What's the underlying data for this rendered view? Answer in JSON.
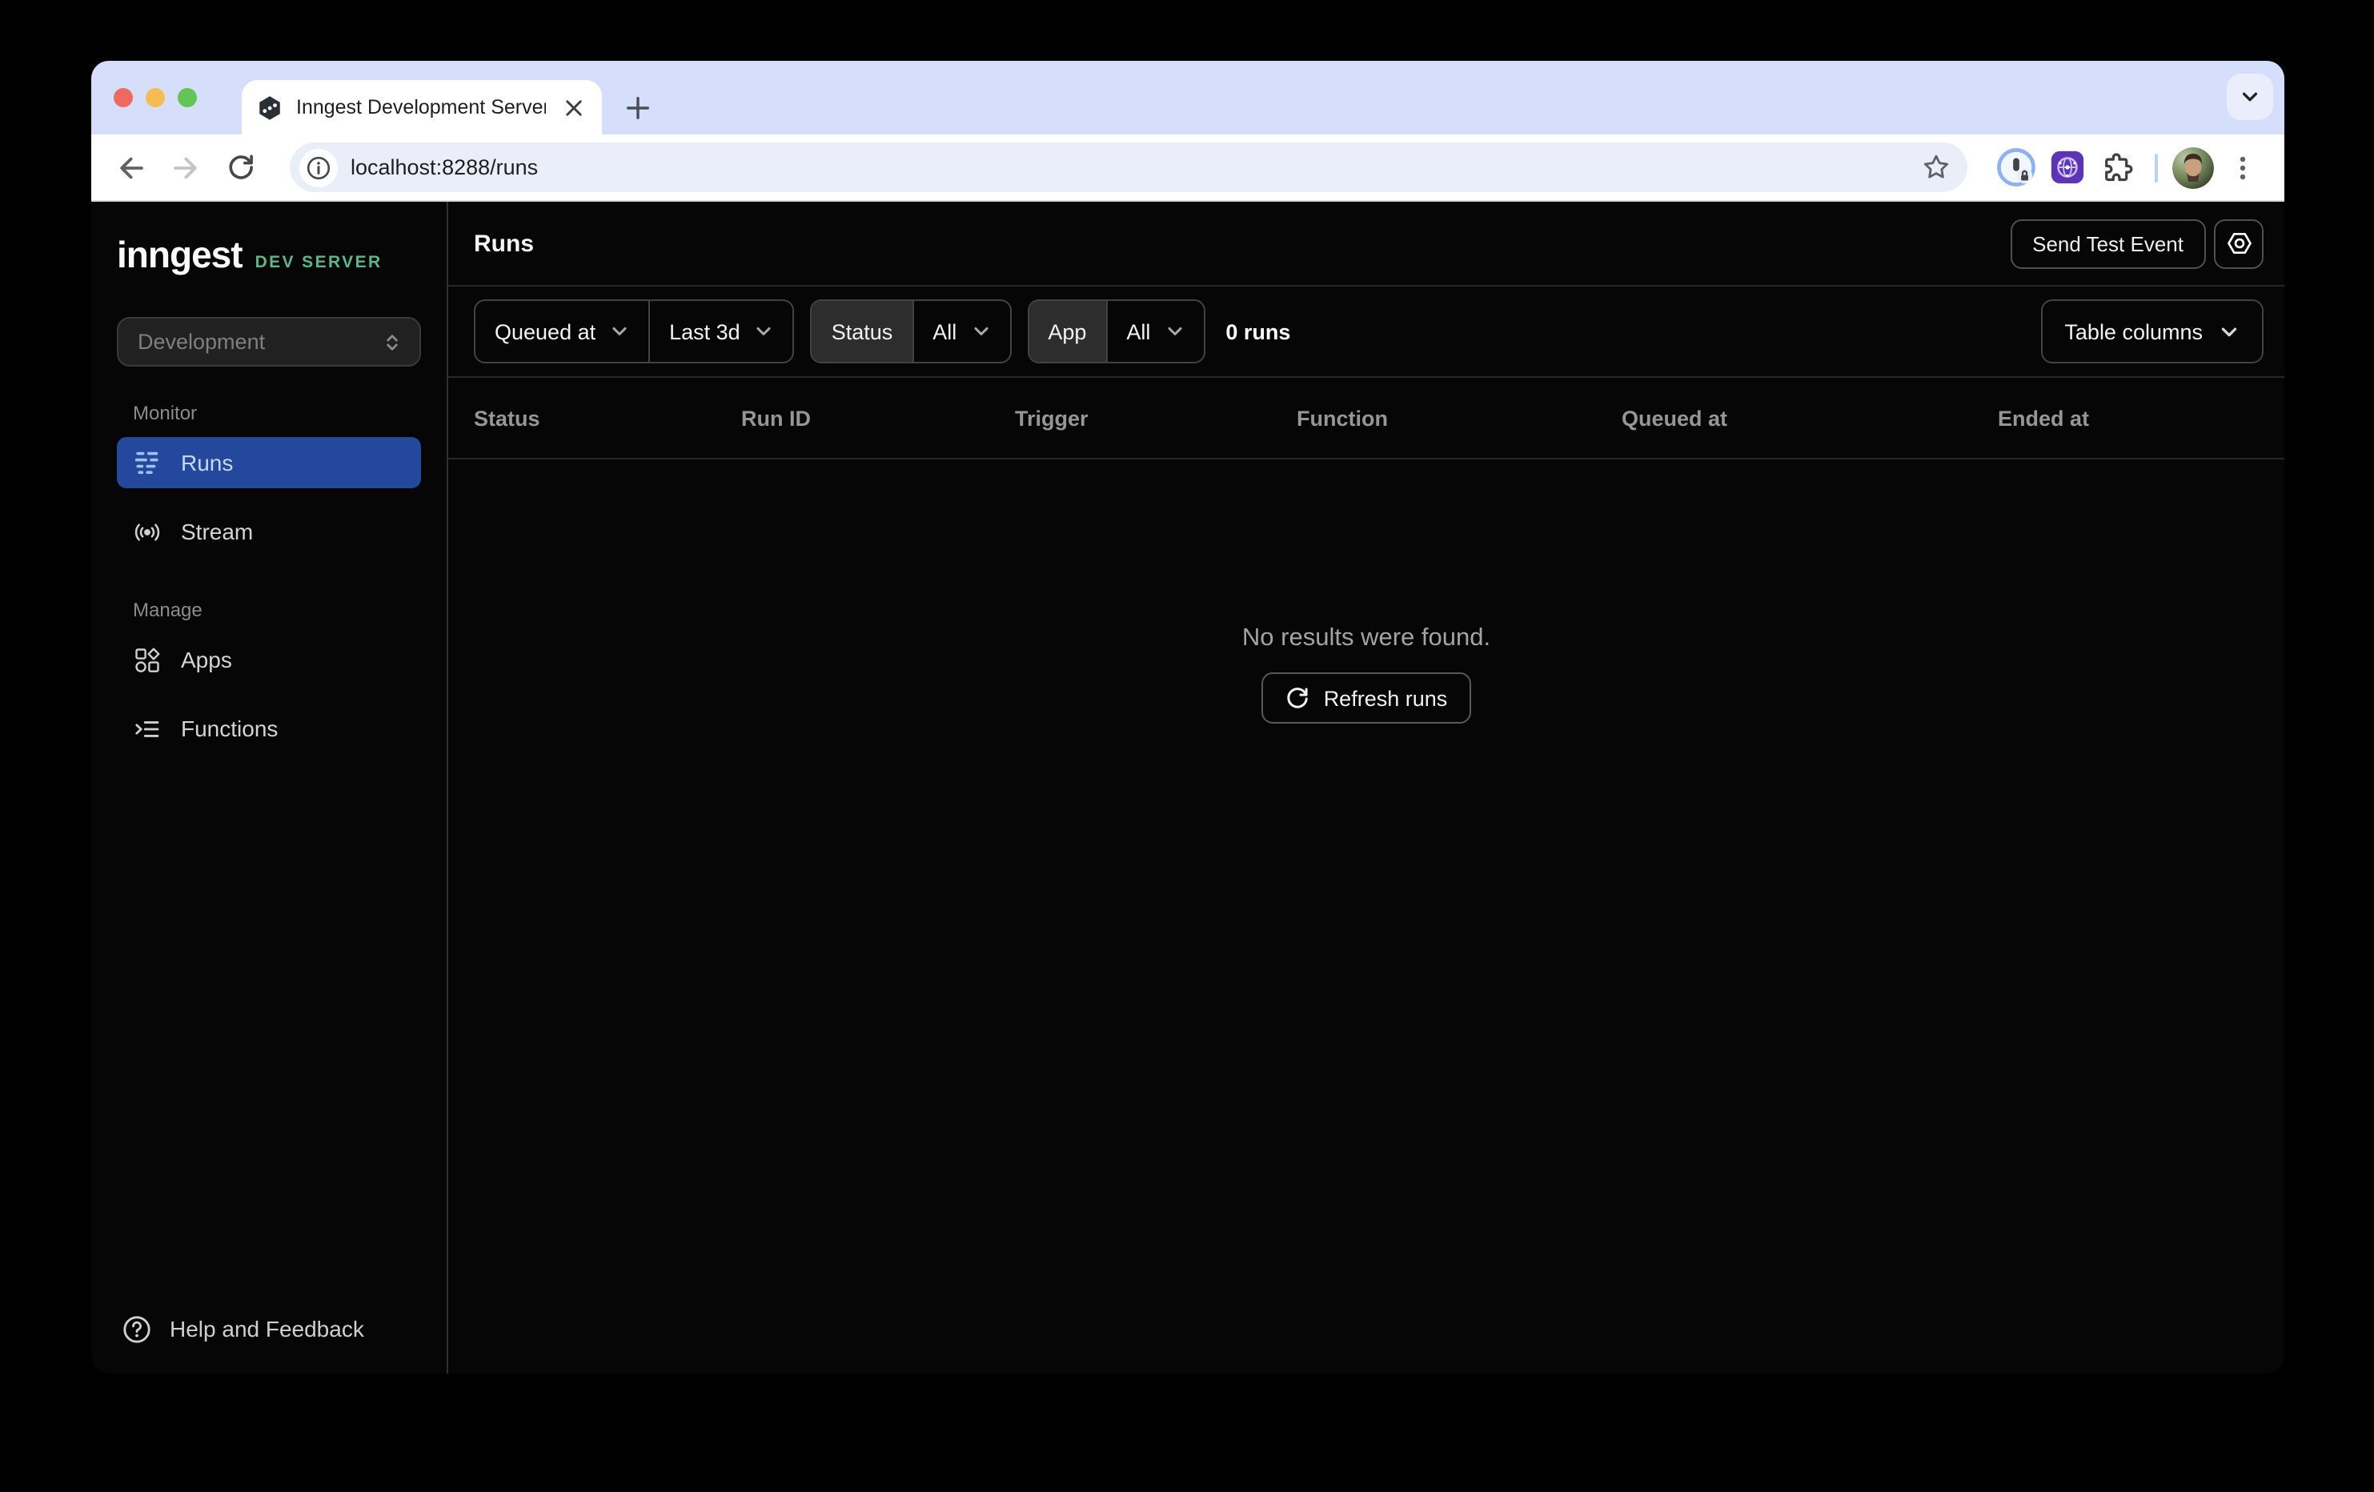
{
  "browser": {
    "tab_title": "Inngest Development Server",
    "url": "localhost:8288/runs"
  },
  "sidebar": {
    "logo": "inngest",
    "logo_badge": "DEV SERVER",
    "env_selector_value": "Development",
    "monitor_section_label": "Monitor",
    "manage_section_label": "Manage",
    "nav_runs_label": "Runs",
    "nav_stream_label": "Stream",
    "nav_apps_label": "Apps",
    "nav_functions_label": "Functions",
    "help_label": "Help and Feedback"
  },
  "header": {
    "title": "Runs",
    "send_test_event_label": "Send Test Event"
  },
  "filters": {
    "time_field_value": "Queued at",
    "time_range_value": "Last 3d",
    "status_label": "Status",
    "status_value": "All",
    "app_label": "App",
    "app_value": "All",
    "runs_count": "0 runs",
    "table_columns_label": "Table columns"
  },
  "table": {
    "columns": [
      "Status",
      "Run ID",
      "Trigger",
      "Function",
      "Queued at",
      "Ended at"
    ]
  },
  "empty_state": {
    "message": "No results were found.",
    "refresh_label": "Refresh runs"
  },
  "colors": {
    "accent_blue": "#24489c",
    "brand_green": "#57b98a",
    "app_bg": "#060606",
    "tabstrip_bg": "#d5dffb",
    "traffic_red": "#ee6a5f",
    "traffic_yellow": "#f5bd4f",
    "traffic_green": "#62c554"
  }
}
